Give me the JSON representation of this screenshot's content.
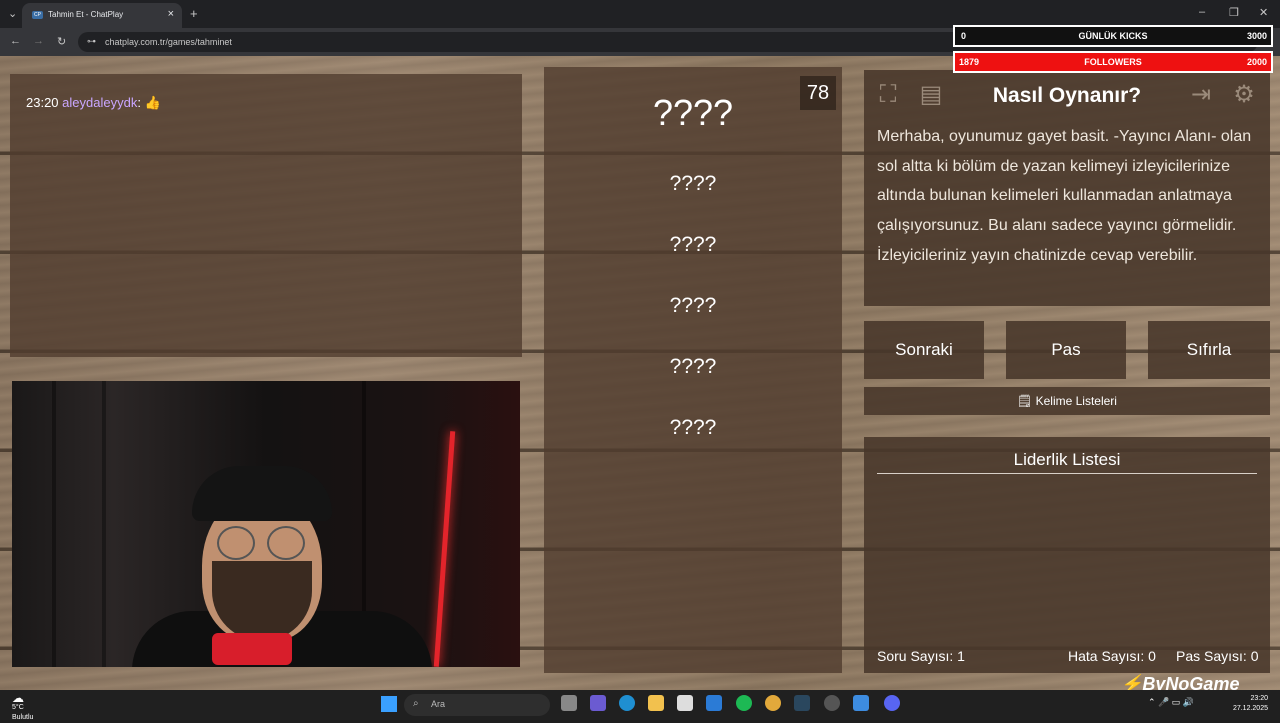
{
  "browser": {
    "tab_title": "Tahmin Et - ChatPlay",
    "tab_favicon": "CP",
    "url": "chatplay.com.tr/games/tahminet"
  },
  "chat": {
    "time": "23:20",
    "user": "aleydaleyydk",
    "message": "👍"
  },
  "game": {
    "timer": "78",
    "words": [
      "????",
      "????",
      "????",
      "????",
      "????",
      "????"
    ],
    "howto_title": "Nasıl Oynanır?",
    "howto_text": "Merhaba, oyunumuz gayet basit. -Yayıncı Alanı- olan sol altta ki bölüm de yazan kelimeyi izleyicilerinize altında bulunan kelimeleri kullanmadan anlatmaya çalışıyorsunuz. Bu alanı sadece yayıncı görmelidir. İzleyicileriniz yayın chatinizde cevap verebilir.",
    "buttons": {
      "next": "Sonraki",
      "pass": "Pas",
      "reset": "Sıfırla"
    },
    "word_lists_label": "Kelime Listeleri",
    "leaderboard_title": "Liderlik Listesi",
    "stats": {
      "question_count": "Soru Sayısı: 1",
      "error_count": "Hata Sayısı: 0",
      "pass_count": "Pas Sayısı: 0"
    }
  },
  "overlay": {
    "kicks": {
      "current": "0",
      "label": "GÜNLÜK KICKS",
      "goal": "3000"
    },
    "followers": {
      "current": "1879",
      "label": "FOLLOWERS",
      "goal": "2000"
    },
    "logo": "ByNoGame"
  },
  "taskbar": {
    "weather_temp": "5°C",
    "weather_desc": "Bulutlu",
    "search_placeholder": "Ara",
    "time": "23:20",
    "date": "27.12.2025"
  },
  "colors": {
    "accent_red": "#e11111",
    "username": "#c9a6ff",
    "panel": "#48372a"
  }
}
